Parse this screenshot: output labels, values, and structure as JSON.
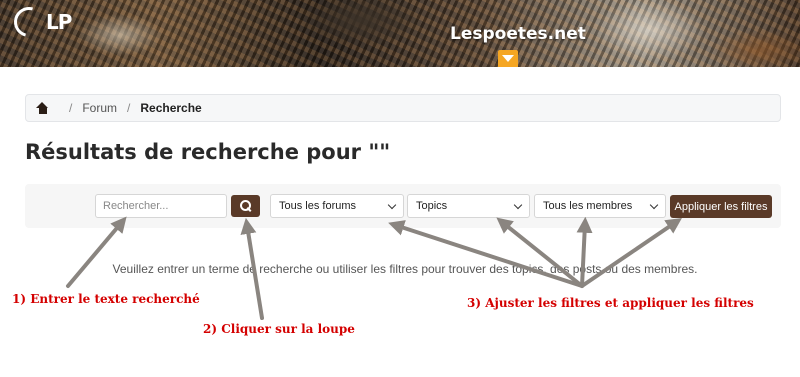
{
  "header": {
    "logo_text": "LP",
    "site_title": "Lespoetes.net"
  },
  "breadcrumb": {
    "items": [
      "Forum",
      "Recherche"
    ]
  },
  "page": {
    "title": "Résultats de recherche pour \"\""
  },
  "filters": {
    "search_placeholder": "Rechercher...",
    "search_value": "",
    "forum_select": "Tous les forums",
    "type_select": "Topics",
    "member_select": "Tous les membres",
    "apply_label": "Appliquer les filtres"
  },
  "message": "Veuillez entrer un terme de recherche ou utiliser les filtres pour trouver des topics, des posts ou des membres.",
  "annotations": {
    "step1": "1) Entrer le texte recherché",
    "step2": "2) Cliquer sur la loupe",
    "step3": "3) Ajuster les filtres et appliquer les filtres"
  },
  "colors": {
    "accent_brown": "#5a3a28",
    "menu_orange": "#f5a623",
    "annotation_red": "#d40000",
    "arrow_gray": "#8a8580"
  }
}
